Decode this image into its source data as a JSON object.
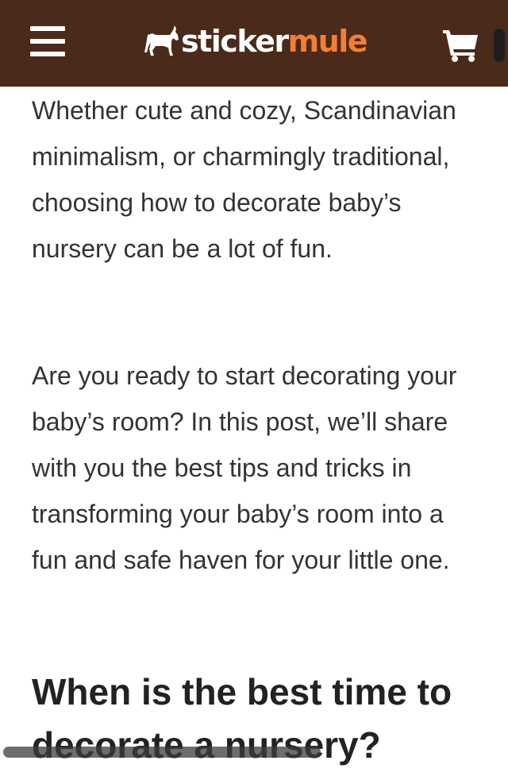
{
  "header": {
    "logo_part1": "sticker",
    "logo_part2": "mule",
    "background_color": "#4a2a1a",
    "accent_color": "#f37f32",
    "menu_icon": "hamburger-menu-icon",
    "cart_icon": "shopping-cart-icon"
  },
  "article": {
    "paragraph1": "Whether cute and cozy, Scandinavian minimalism, or charmingly traditional, choosing how to decorate baby’s nursery can be a lot of fun.",
    "paragraph2": "Are you ready to start decorating your baby’s room? In this post, we’ll share with you the best tips and tricks in transforming your baby’s room into a fun and safe haven for your little one.",
    "heading": "When is the best time to decorate a nursery?"
  }
}
